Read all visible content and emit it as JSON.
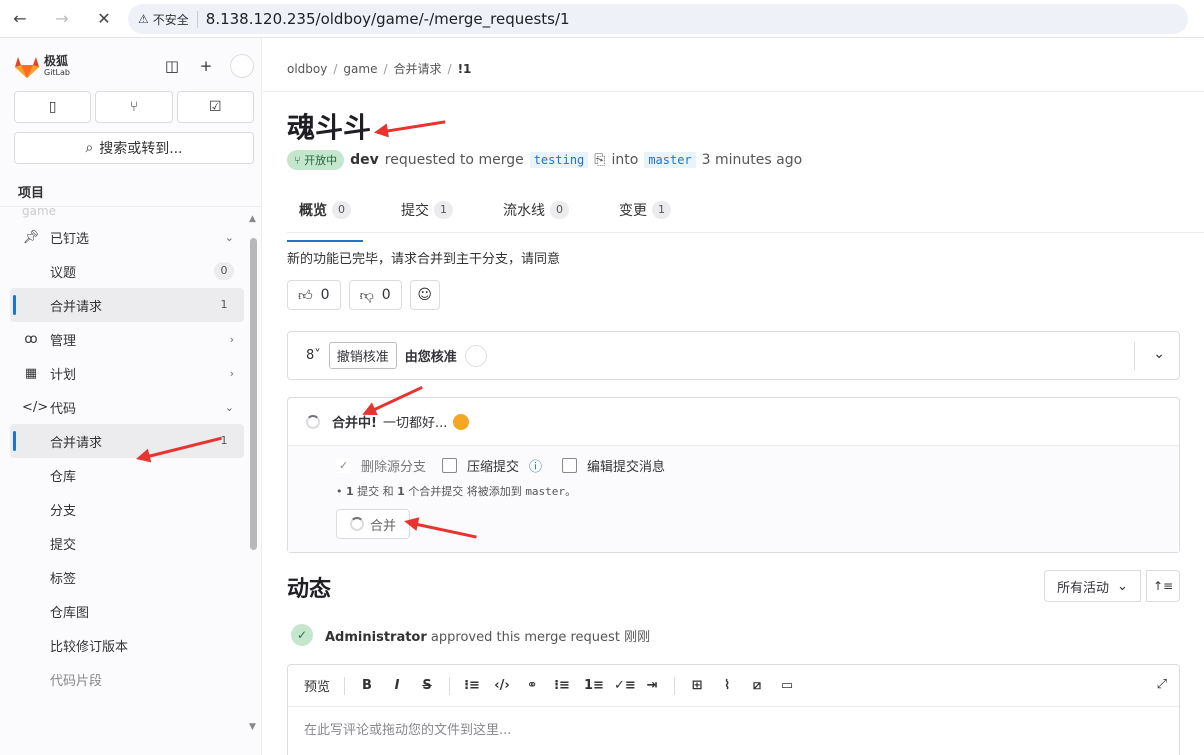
{
  "browser": {
    "back": "←",
    "forward": "→",
    "stop": "✕",
    "insecure_label": "不安全",
    "url": "8.138.120.235/oldboy/game/-/merge_requests/1"
  },
  "sidebar": {
    "brand_name": "极狐",
    "brand_sub": "GitLab",
    "search_label": "搜索或转到...",
    "section_title": "项目",
    "ghost_item": "game",
    "items": [
      {
        "label": "已钉选",
        "icon": "pin-icon"
      },
      {
        "label": "议题",
        "count": "0"
      },
      {
        "label": "合并请求",
        "count": "1"
      },
      {
        "label": "管理",
        "icon": "users-icon"
      },
      {
        "label": "计划",
        "icon": "calendar-icon"
      },
      {
        "label": "代码",
        "icon": "code-icon"
      },
      {
        "label": "合并请求",
        "count": "1"
      },
      {
        "label": "仓库"
      },
      {
        "label": "分支"
      },
      {
        "label": "提交"
      },
      {
        "label": "标签"
      },
      {
        "label": "仓库图"
      },
      {
        "label": "比较修订版本"
      },
      {
        "label": "代码片段"
      }
    ]
  },
  "breadcrumb": [
    "oldboy",
    "game",
    "合并请求",
    "!1"
  ],
  "mr": {
    "title": "魂斗斗",
    "status": "开放中",
    "author": "dev",
    "requested_text": "requested to merge",
    "source_branch": "testing",
    "into_text": "into",
    "target_branch": "master",
    "time": "3 minutes ago",
    "description": "新的功能已完毕，请求合并到主干分支，请同意"
  },
  "tabs": [
    {
      "label": "概览",
      "count": "0"
    },
    {
      "label": "提交",
      "count": "1"
    },
    {
      "label": "流水线",
      "count": "0"
    },
    {
      "label": "变更",
      "count": "1"
    }
  ],
  "reactions": {
    "thumbs_up": "0",
    "thumbs_down": "0"
  },
  "approval": {
    "approvers_count": "8",
    "revoke_label": "撤销核准",
    "approved_by": "由您核准"
  },
  "merge": {
    "status_title": "合并中!",
    "status_text": "一切都好...",
    "opt_delete_source": "删除源分支",
    "opt_squash": "压缩提交",
    "opt_edit_message": "编辑提交消息",
    "note_count1": "1",
    "note_mid1": "提交 和",
    "note_count2": "1",
    "note_mid2": "个合并提交 将被添加到",
    "note_branch": "master",
    "note_end": "。",
    "button_label": "合并"
  },
  "activity": {
    "title": "动态",
    "filter_label": "所有活动",
    "event_user": "Administrator",
    "event_text": "approved this merge request",
    "event_time": "刚刚"
  },
  "editor": {
    "preview_label": "预览",
    "placeholder": "在此写评论或拖动您的文件到这里..."
  }
}
